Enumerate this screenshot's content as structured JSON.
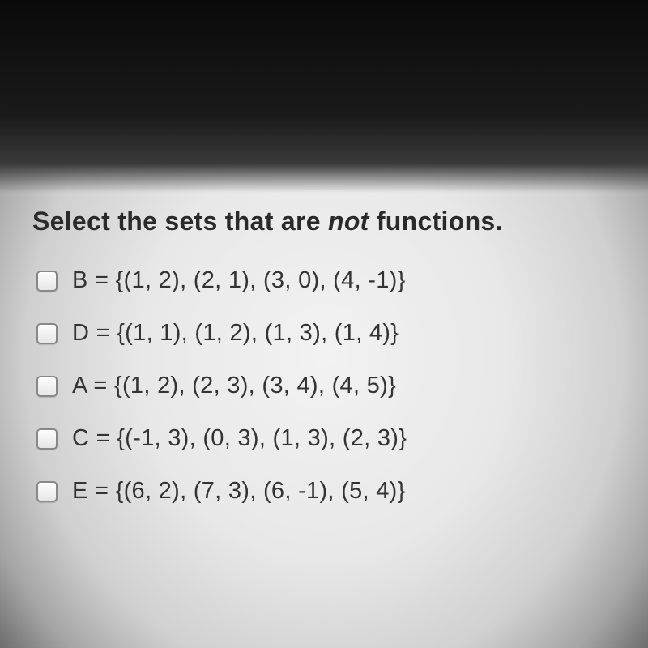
{
  "question": {
    "prefix": "Select the sets that are ",
    "emphasis": "not",
    "suffix": " functions."
  },
  "options": [
    {
      "label": "B = {(1, 2), (2, 1), (3, 0), (4, -1)}"
    },
    {
      "label": "D = {(1, 1), (1, 2), (1, 3), (1, 4)}"
    },
    {
      "label": "A = {(1, 2), (2, 3), (3, 4), (4, 5)}"
    },
    {
      "label": "C = {(-1, 3), (0, 3), (1, 3), (2, 3)}"
    },
    {
      "label": "E = {(6, 2), (7, 3), (6, -1), (5, 4)}"
    }
  ]
}
